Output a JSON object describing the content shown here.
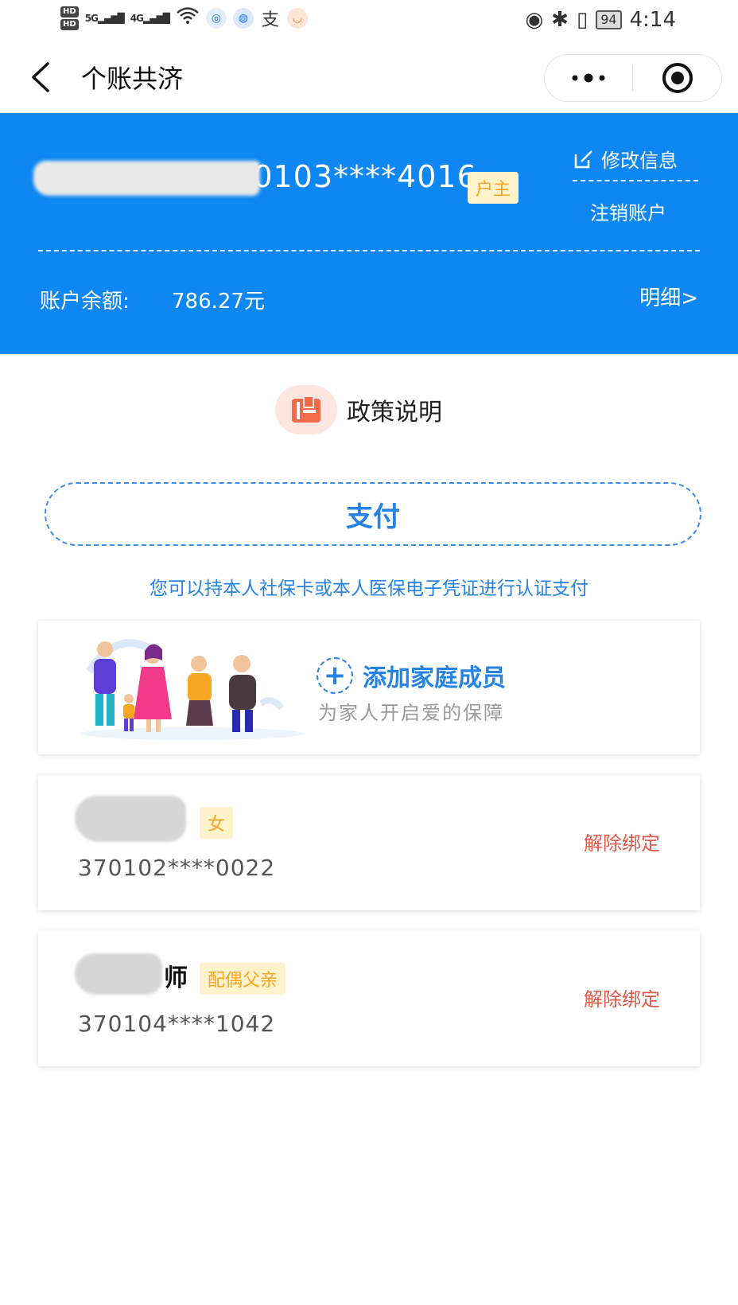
{
  "status_bar": {
    "hd1": "HD",
    "hd2": "HD",
    "sim1": "1",
    "sim2": "2",
    "net1": "5G",
    "net2": "4G",
    "battery": "94",
    "time": "4:14"
  },
  "header": {
    "title": "个账共济"
  },
  "account": {
    "id_masked": "0103****4016",
    "role_badge": "户主",
    "edit_label": "修改信息",
    "cancel_label": "注销账户",
    "balance_label": "账户余额:",
    "balance_value": "786.27元",
    "detail_label": "明细>"
  },
  "policy": {
    "label": "政策说明"
  },
  "pay": {
    "label": "支付",
    "hint": "您可以持本人社保卡或本人医保电子凭证进行认证支付"
  },
  "add_member": {
    "title": "添加家庭成员",
    "subtitle": "为家人开启爱的保障"
  },
  "members": [
    {
      "badge": "女",
      "id_masked": "370102****0022",
      "action": "解除绑定"
    },
    {
      "name_tail": "师",
      "badge": "配偶父亲",
      "id_masked": "370104****1042",
      "action": "解除绑定"
    }
  ],
  "colors": {
    "primary_blue": "#0e87f2",
    "link_blue": "#2583e6",
    "badge_bg": "#fff3cc",
    "badge_text": "#f5a623",
    "danger": "#e2584a"
  }
}
